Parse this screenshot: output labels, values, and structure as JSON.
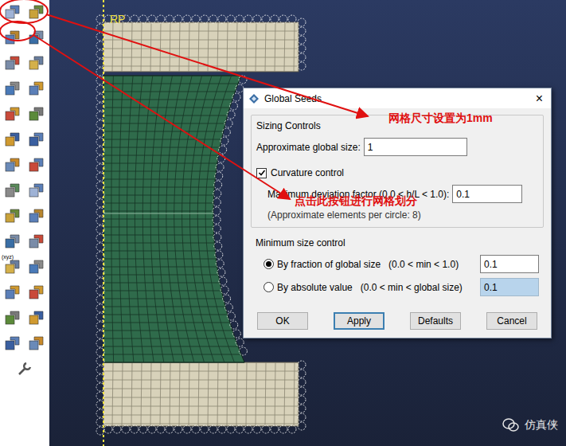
{
  "toolbar": {
    "icon_text": "(xyz)"
  },
  "viewport": {
    "reference_point": "RP"
  },
  "dialog": {
    "title": "Global Seeds",
    "close": "×",
    "sizing_group": "Sizing Controls",
    "global_size": {
      "label": "Approximate global size:",
      "value": "1"
    },
    "curvature": {
      "label": "Curvature control",
      "checked": true
    },
    "deviation": {
      "label": "Maximum deviation factor (0.0 < h/L < 1.0):",
      "value": "0.1"
    },
    "elements_note": "(Approximate elements per circle: 8)",
    "min_group": "Minimum size control",
    "min_options": [
      {
        "label": "By fraction of global size",
        "range": "(0.0 < min < 1.0)",
        "value": "0.1",
        "selected": true
      },
      {
        "label": "By absolute value",
        "range": "(0.0 < min < global size)",
        "value": "0.1",
        "selected": false
      }
    ],
    "buttons": [
      "OK",
      "Apply",
      "Defaults",
      "Cancel"
    ]
  },
  "annotations": [
    "网格尺寸设置为1mm",
    "点击此按钮进行网格划分"
  ],
  "watermark": "仿真侠"
}
